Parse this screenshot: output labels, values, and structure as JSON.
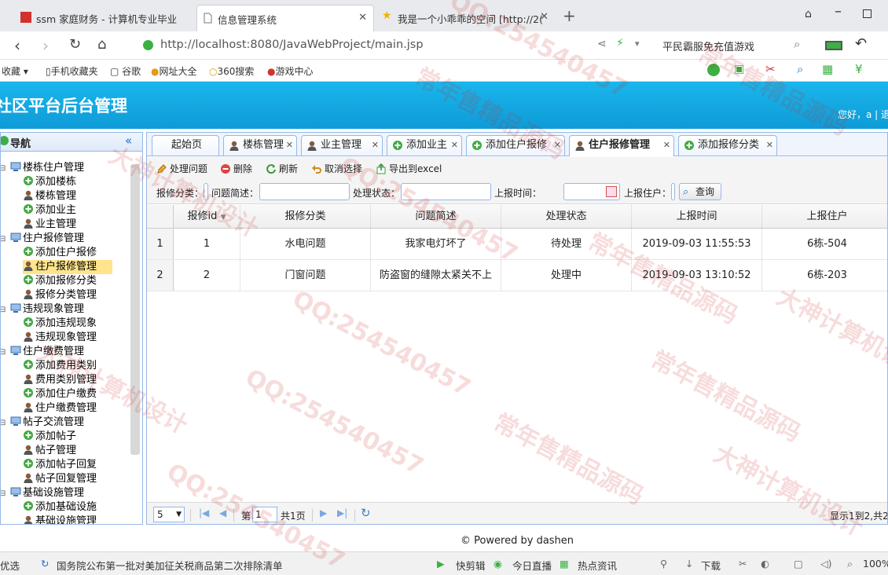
{
  "browser": {
    "tabs": [
      {
        "title": "ssm 家庭财务 - 计算机专业毕业"
      },
      {
        "title": "信息管理系统"
      },
      {
        "title": "我是一个小乖乖的空间 [http://2("
      }
    ],
    "url": "http://localhost:8080/JavaWebProject/main.jsp",
    "search_hint": "平民霸服免充值游戏",
    "bookmarks": [
      "收藏",
      "手机收藏夹",
      "谷歌",
      "网址大全",
      "360搜索",
      "游戏中心"
    ]
  },
  "app": {
    "title": "社区平台后台管理",
    "user_info": "您好，a | 退",
    "nav_title": "导航",
    "tree": [
      {
        "label": "楼栋住户管理",
        "children": [
          "添加楼栋",
          "楼栋管理",
          "添加业主",
          "业主管理"
        ]
      },
      {
        "label": "住户报修管理",
        "children": [
          "添加住户报修",
          "住户报修管理",
          "添加报修分类",
          "报修分类管理"
        ]
      },
      {
        "label": "违规现象管理",
        "children": [
          "添加违规现象",
          "违规现象管理"
        ]
      },
      {
        "label": "住户缴费管理",
        "children": [
          "添加费用类别",
          "费用类别管理",
          "添加住户缴费",
          "住户缴费管理"
        ]
      },
      {
        "label": "帖子交流管理",
        "children": [
          "添加帖子",
          "帖子管理",
          "添加帖子回复",
          "帖子回复管理"
        ]
      },
      {
        "label": "基础设施管理",
        "children": [
          "添加基础设施",
          "基础设施管理"
        ]
      }
    ],
    "tabs": [
      "起始页",
      "楼栋管理",
      "业主管理",
      "添加业主",
      "添加住户报修",
      "住户报修管理",
      "添加报修分类"
    ],
    "active_tab": "住户报修管理",
    "toolbar": [
      "处理问题",
      "删除",
      "刷新",
      "取消选择",
      "导出到excel"
    ],
    "search": {
      "category_label": "报修分类：",
      "desc_label": "问题简述：",
      "state_label": "处理状态：",
      "time_label": "上报时间：",
      "user_label": "上报住户：",
      "button": "查询"
    },
    "grid": {
      "columns": [
        "报修id",
        "报修分类",
        "问题简述",
        "处理状态",
        "上报时间",
        "上报住户"
      ],
      "rows": [
        {
          "rownum": "1",
          "id": "1",
          "category": "水电问题",
          "desc": "我家电灯坏了",
          "state": "待处理",
          "time": "2019-09-03 11:55:53",
          "user": "6栋-504"
        },
        {
          "rownum": "2",
          "id": "2",
          "category": "门窗问题",
          "desc": "防盗窗的缝隙太紧关不上",
          "state": "处理中",
          "time": "2019-09-03 13:10:52",
          "user": "6栋-203"
        }
      ]
    },
    "pager": {
      "page_size": "5",
      "page_prefix": "第",
      "page": "1",
      "page_total": "共1页",
      "display": "显示1到2,共2"
    },
    "footer": "© Powered by dashen"
  },
  "statusbar": {
    "left": "优选",
    "news": "国务院公布第一批对美加征关税商品第二次排除清单",
    "items": [
      "快剪辑",
      "今日直播",
      "热点资讯",
      "下载",
      "100%"
    ]
  },
  "watermarks": [
    "QQ:254540457",
    "常年售精品源码",
    "大神计算机设计"
  ],
  "colors": {
    "header": "#0ea3de",
    "border": "#95b8e7",
    "selected": "#ffe48d"
  }
}
